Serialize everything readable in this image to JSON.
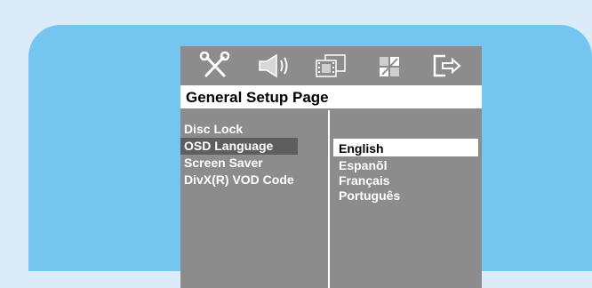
{
  "colors": {
    "page_background": "#dcebf8",
    "panel": "#74c6ee",
    "osd_background": "#8c8c8c",
    "menu_highlight": "#5e5e5e",
    "option_highlight": "#ffffff"
  },
  "icons": [
    "setup-tools-icon",
    "audio-speaker-icon",
    "video-film-icon",
    "preference-grid-icon",
    "exit-icon"
  ],
  "page_title": "General Setup Page",
  "menu": {
    "items": [
      {
        "label": "Disc Lock",
        "selected": false
      },
      {
        "label": "OSD Language",
        "selected": true
      },
      {
        "label": "Screen Saver",
        "selected": false
      },
      {
        "label": "DivX(R) VOD Code",
        "selected": false
      }
    ]
  },
  "options": {
    "items": [
      {
        "label": "English",
        "selected": true
      },
      {
        "label": "Espanõl",
        "selected": false
      },
      {
        "label": "Français",
        "selected": false
      },
      {
        "label": "Português",
        "selected": false
      }
    ]
  }
}
